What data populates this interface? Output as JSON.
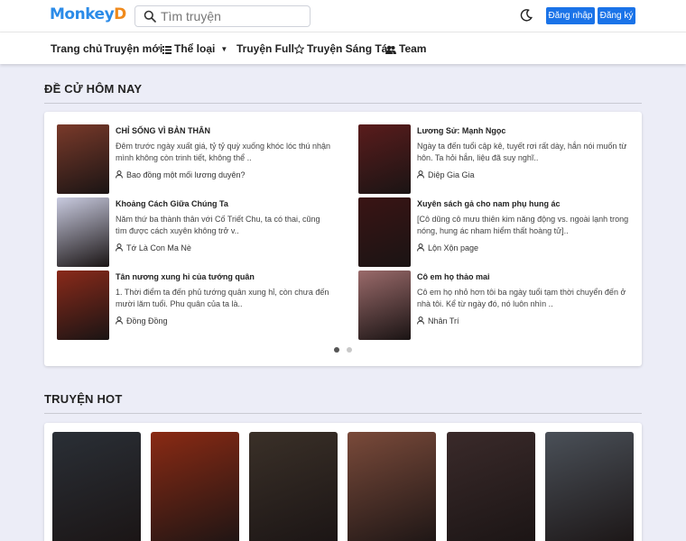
{
  "header": {
    "logo_part1": "Monkey",
    "logo_part2": "D",
    "search_placeholder": "Tìm truyện",
    "login_label": "Đăng nhập",
    "register_label": "Đăng ký"
  },
  "nav": {
    "home": "Trang chủ",
    "new": "Truyện mới",
    "genres": "Thể loại",
    "full": "Truyện Full",
    "creative": "Truyện Sáng Tác",
    "team": "Team"
  },
  "recommend": {
    "title": "ĐỀ CỬ HÔM NAY",
    "items": [
      {
        "title": "CHỈ SỐNG VÌ BẢN THÂN",
        "desc": "Đêm trước ngày xuất giá, tỷ tỷ quỳ xuống khóc lóc thú nhận mình không còn trinh tiết, không thể ..",
        "author": "Bao đồng một mối lương duyên?",
        "thumb_color": "#7a3a2a"
      },
      {
        "title": "Lương Sử: Mạnh Ngọc",
        "desc": "Ngày ta đến tuổi cập kê, tuyết rơi rất dày, hắn nói muốn từ hôn. Ta hỏi hắn, liệu đã suy nghĩ..",
        "author": "Diệp Gia Gia",
        "thumb_color": "#5a1c1c"
      },
      {
        "title": "Khoảng Cách Giữa Chúng Ta",
        "desc": " Năm thứ ba thành thân với Cố Triết Chu, ta có thai, cũng tìm được cách xuyên không trở v..",
        "author": "Tớ Là Con Ma Nè",
        "thumb_color": "#c9cbe0"
      },
      {
        "title": "Xuyên sách gả cho nam phụ hung ác",
        "desc": "[Cô dũng cô mưu thiên kim năng động vs. ngoài lạnh trong nóng, hung ác nham hiểm thất hoàng tử]..",
        "author": "Lộn Xộn page",
        "thumb_color": "#3a1414"
      },
      {
        "title": "Tân nương xung hỉ của tướng quân",
        "desc": "1. Thời điểm ta đến phủ tướng quân xung hỉ, còn chưa đến mười lăm tuổi. Phu quân của ta là..",
        "author": "Đồng Đồng",
        "thumb_color": "#8a2a1a"
      },
      {
        "title": "Cô em họ thảo mai",
        "desc": "Cô em họ nhỏ hơn tôi ba ngày tuổi tạm thời chuyển đến ở nhà tôi. Kể từ ngày đó, nó luôn nhìn ..",
        "author": "Nhân Trí",
        "thumb_color": "#9a6a6a"
      }
    ]
  },
  "hot": {
    "title": "TRUYỆN HOT",
    "colors": [
      "#2a2f36",
      "#8a2a14",
      "#3a3028",
      "#7a4a3a",
      "#3a2a2a",
      "#4a5058"
    ]
  },
  "colors": {
    "primary_button": "#1a73e8",
    "background": "#ecedf7"
  }
}
